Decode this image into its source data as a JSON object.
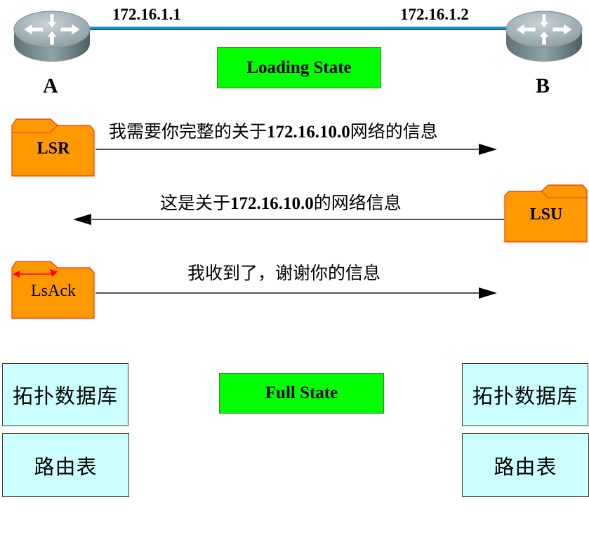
{
  "routers": {
    "a": {
      "label": "A",
      "ip": "172.16.1.1",
      "icon": "router-icon"
    },
    "b": {
      "label": "B",
      "ip": "172.16.1.2",
      "icon": "router-icon"
    }
  },
  "colors": {
    "state_box": "#00ff00",
    "packet_folder": "#ff9900",
    "packet_border": "#ff3300",
    "info_box": "#ccffff",
    "link": "#1a8fc4"
  },
  "states": {
    "loading": "Loading State",
    "full": "Full State"
  },
  "messages": [
    {
      "packet": "LSR",
      "direction": "A->B",
      "text_pre": "我需要你完整的关于",
      "text_bold": "172.16.10.0",
      "text_post": "网络的信息"
    },
    {
      "packet": "LSU",
      "direction": "B->A",
      "text_pre": "这是关于",
      "text_bold": "172.16.10.0",
      "text_post": "的网络信息"
    },
    {
      "packet": "LsAck",
      "direction": "A->B",
      "text_pre": "我收到了，谢谢你的信息",
      "text_bold": "",
      "text_post": ""
    }
  ],
  "databases": {
    "left": {
      "topology": "拓扑数据库",
      "routing_table": "路由表"
    },
    "right": {
      "topology": "拓扑数据库",
      "routing_table": "路由表"
    }
  }
}
